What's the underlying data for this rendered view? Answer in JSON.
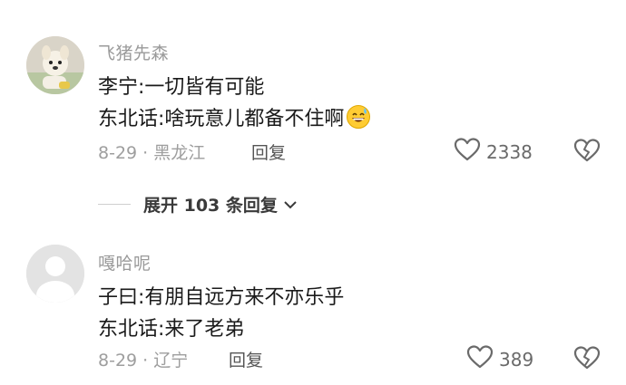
{
  "comments": [
    {
      "username": "飞猪先森",
      "lines": [
        "李宁:一切皆有可能",
        "东北话:啥玩意儿都备不住啊"
      ],
      "meta": "8-29 · 黑龙江",
      "reply_label": "回复",
      "likes": "2338",
      "emoji": "grinning-sweat-emoji",
      "avatar": "dog-photo-avatar"
    },
    {
      "username": "嘎哈呢",
      "lines": [
        "子曰:有朋自远方来不亦乐乎",
        "东北话:来了老弟"
      ],
      "meta": "8-29 · 辽宁",
      "reply_label": "回复",
      "likes": "389",
      "avatar": "default-avatar"
    }
  ],
  "expand_replies": {
    "label": "展开 103 条回复"
  }
}
